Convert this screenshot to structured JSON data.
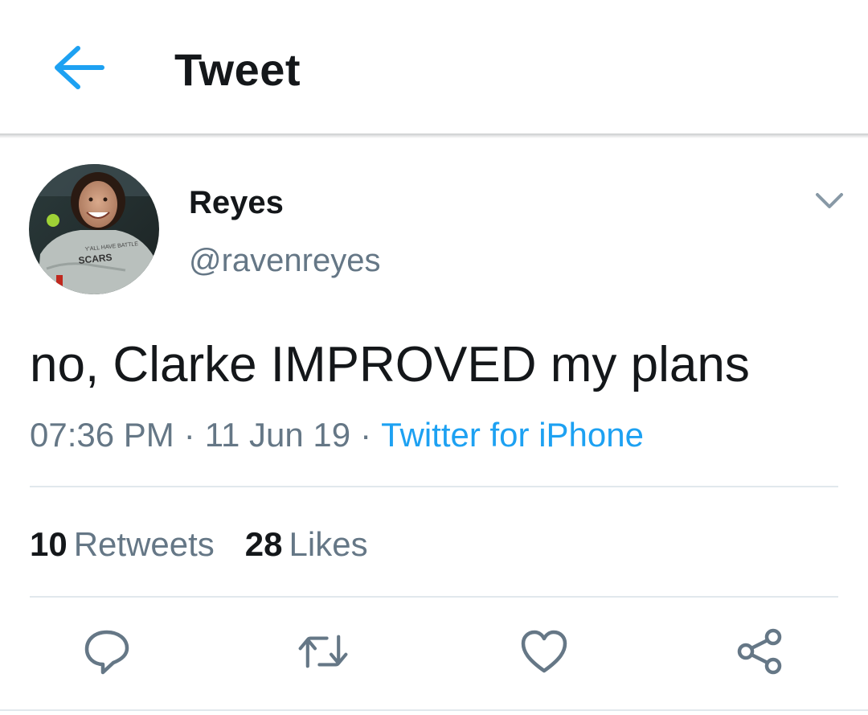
{
  "header": {
    "title": "Tweet",
    "back_icon": "arrow-left-icon",
    "accent_color": "#1da1f2"
  },
  "author": {
    "display_name": "Reyes",
    "handle": "@ravenreyes",
    "avatar_shirt_text_top": "Y'ALL HAVE BATTLE",
    "avatar_shirt_text_main": "SCARS"
  },
  "tweet": {
    "text": "no, Clarke IMPROVED my plans",
    "time": "07:36 PM",
    "separator": "·",
    "date": "11 Jun 19",
    "source": "Twitter for iPhone"
  },
  "stats": {
    "retweets_count": "10",
    "retweets_label": "Retweets",
    "likes_count": "28",
    "likes_label": "Likes"
  },
  "actions": {
    "reply_icon": "reply-icon",
    "retweet_icon": "retweet-icon",
    "like_icon": "heart-icon",
    "share_icon": "share-icon"
  },
  "colors": {
    "text_primary": "#14171a",
    "text_secondary": "#657786",
    "link": "#1da1f2",
    "divider": "#e1e8ed"
  }
}
